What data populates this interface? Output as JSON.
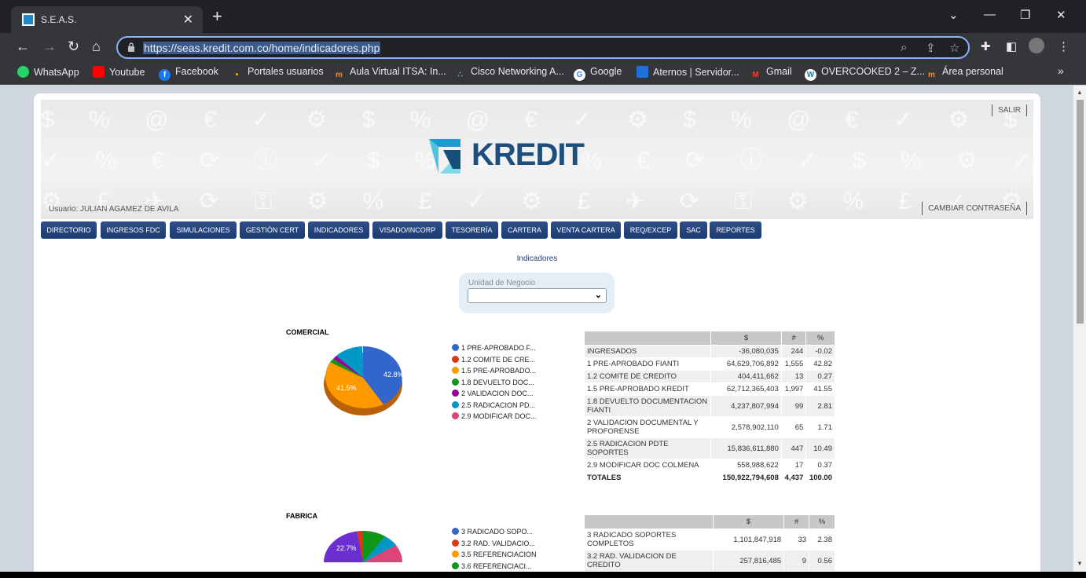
{
  "browser": {
    "tab_title": "S.E.A.S.",
    "url": "https://seas.kredit.com.co/home/indicadores.php",
    "bookmarks": [
      "WhatsApp",
      "Youtube",
      "Facebook",
      "Portales usuarios",
      "Aula Virtual ITSA: In...",
      "Cisco Networking A...",
      "Google",
      "Aternos | Servidor...",
      "Gmail",
      "OVERCOOKED 2 – Z...",
      "Área personal"
    ],
    "more_bookmarks": "»"
  },
  "header": {
    "logo_text": "KREDIT",
    "salir": "SALIR",
    "usuario": "Usuario: JULIAN AGAMEZ DE AVILA",
    "cambiar": "CAMBIAR CONTRASEÑA"
  },
  "menu": [
    "DIRECTORIO",
    "INGRESOS FDC",
    "SIMULACIONES",
    "GESTIÓN CERT",
    "INDICADORES",
    "VISADO/INCORP",
    "TESORERÍA",
    "CARTERA",
    "VENTA CARTERA",
    "REQ/EXCEP",
    "SAC",
    "REPORTES"
  ],
  "page": {
    "heading": "Indicadores",
    "unidad_label": "Unidad de Negocio",
    "unidad_value": ""
  },
  "colors": {
    "blue": "#3366cc",
    "red": "#dc3912",
    "orange": "#ff9900",
    "green": "#109618",
    "purple": "#990099",
    "teal": "#0099c6",
    "pink": "#dd4477",
    "violet": "#6b2fd1"
  },
  "comercial": {
    "title": "COMERCIAL",
    "legend": [
      "1 PRE-APROBADO F...",
      "1.2 COMITE DE CRE...",
      "1.5 PRE-APROBADO...",
      "1.8 DEVUELTO DOC...",
      "2 VALIDACION DOC...",
      "2.5 RADICACION PD...",
      "2.9 MODIFICAR DOC..."
    ],
    "pie_labels": [
      "42.8%",
      "41.5%"
    ],
    "table_headers": [
      "",
      "$",
      "#",
      "%"
    ],
    "rows": [
      [
        "INGRESADOS",
        "-36,080,035",
        "244",
        "-0.02"
      ],
      [
        "1 PRE-APROBADO FIANTI",
        "64,629,706,892",
        "1,555",
        "42.82"
      ],
      [
        "1.2 COMITE DE CREDITO",
        "404,411,662",
        "13",
        "0.27"
      ],
      [
        "1.5 PRE-APROBADO KREDIT",
        "62,712,365,403",
        "1,997",
        "41.55"
      ],
      [
        "1.8 DEVUELTO DOCUMENTACION FIANTI",
        "4,237,807,994",
        "99",
        "2.81"
      ],
      [
        "2 VALIDACION DOCUMENTAL Y PROFORENSE",
        "2,578,902,110",
        "65",
        "1.71"
      ],
      [
        "2.5 RADICACION PDTE SOPORTES",
        "15,836,611,880",
        "447",
        "10.49"
      ],
      [
        "2.9 MODIFICAR DOC COLMENA",
        "558,988,622",
        "17",
        "0.37"
      ],
      [
        "TOTALES",
        "150,922,794,608",
        "4,437",
        "100.00"
      ]
    ]
  },
  "fabrica": {
    "title": "FABRICA",
    "legend": [
      "3 RADICADO SOPO...",
      "3.2 RAD. VALIDACIO...",
      "3.5 REFERENCIACION",
      "3.6 REFERENCIACI..."
    ],
    "pie_labels": [
      "22.7%"
    ],
    "table_headers": [
      "",
      "$",
      "#",
      "%"
    ],
    "rows": [
      [
        "3 RADICADO SOPORTES COMPLETOS",
        "1,101,847,918",
        "33",
        "2.38"
      ],
      [
        "3.2 RAD. VALIDACION DE CREDITO",
        "257,816,485",
        "9",
        "0.56"
      ]
    ]
  }
}
